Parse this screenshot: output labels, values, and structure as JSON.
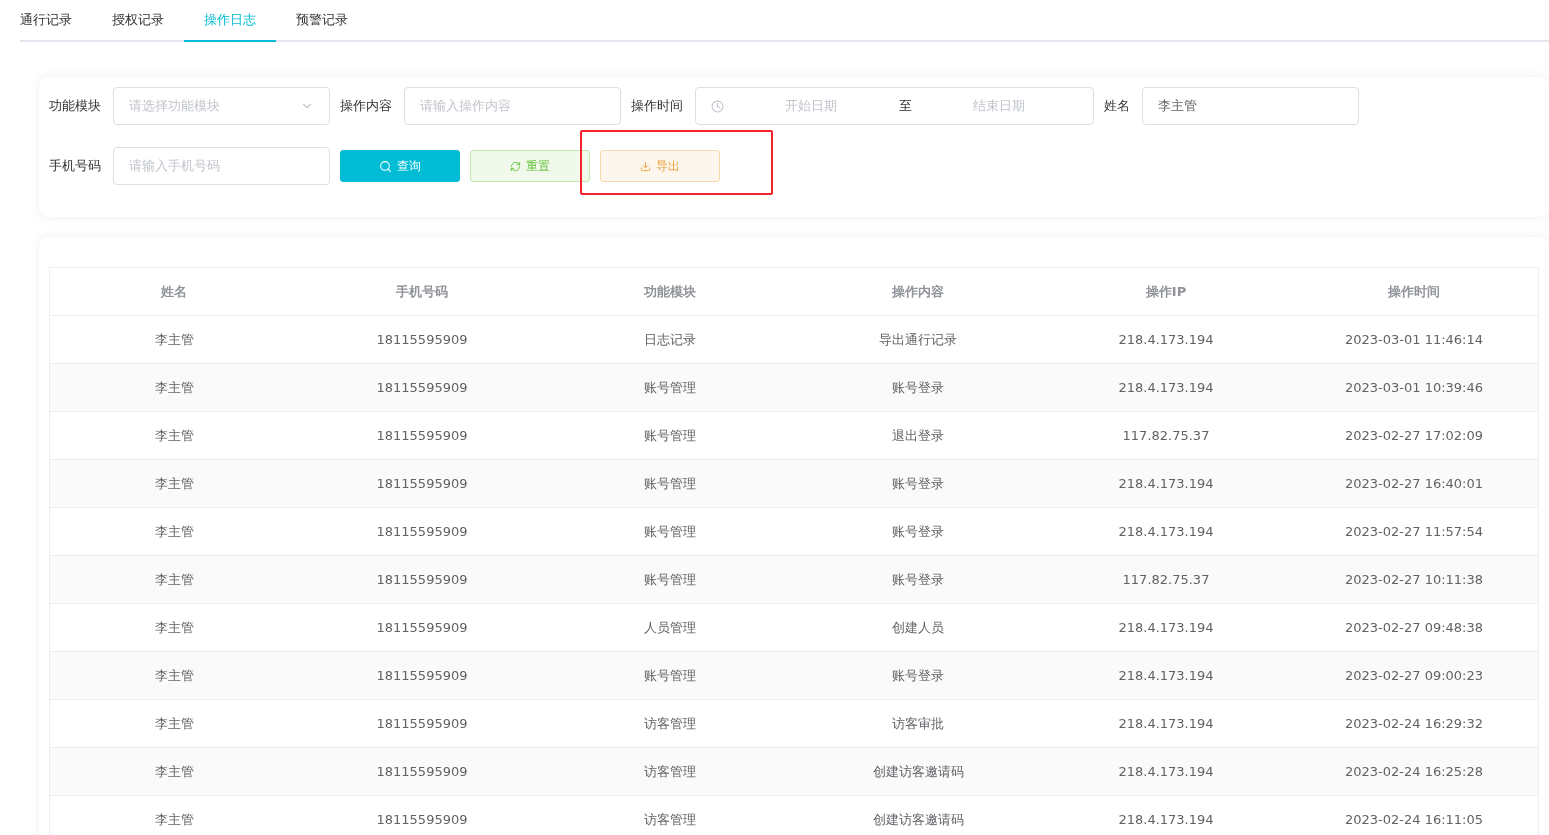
{
  "tabs": [
    {
      "label": "通行记录",
      "selected": false
    },
    {
      "label": "授权记录",
      "selected": false
    },
    {
      "label": "操作日志",
      "selected": true
    },
    {
      "label": "预警记录",
      "selected": false
    }
  ],
  "filters": {
    "module": {
      "label": "功能模块",
      "placeholder": "请选择功能模块"
    },
    "content": {
      "label": "操作内容",
      "placeholder": "请输入操作内容"
    },
    "time": {
      "label": "操作时间",
      "start_placeholder": "开始日期",
      "separator": "至",
      "end_placeholder": "结束日期"
    },
    "name": {
      "label": "姓名",
      "value": "李主管"
    },
    "phone": {
      "label": "手机号码",
      "placeholder": "请输入手机号码"
    }
  },
  "buttons": [
    {
      "kind": "search",
      "label": "查询"
    },
    {
      "kind": "reset",
      "label": "重置"
    },
    {
      "kind": "export",
      "label": "导出",
      "highlighted": true
    }
  ],
  "table": {
    "columns": [
      "姓名",
      "手机号码",
      "功能模块",
      "操作内容",
      "操作IP",
      "操作时间"
    ],
    "rows": [
      [
        "李主管",
        "18115595909",
        "日志记录",
        "导出通行记录",
        "218.4.173.194",
        "2023-03-01 11:46:14"
      ],
      [
        "李主管",
        "18115595909",
        "账号管理",
        "账号登录",
        "218.4.173.194",
        "2023-03-01 10:39:46"
      ],
      [
        "李主管",
        "18115595909",
        "账号管理",
        "退出登录",
        "117.82.75.37",
        "2023-02-27 17:02:09"
      ],
      [
        "李主管",
        "18115595909",
        "账号管理",
        "账号登录",
        "218.4.173.194",
        "2023-02-27 16:40:01"
      ],
      [
        "李主管",
        "18115595909",
        "账号管理",
        "账号登录",
        "218.4.173.194",
        "2023-02-27 11:57:54"
      ],
      [
        "李主管",
        "18115595909",
        "账号管理",
        "账号登录",
        "117.82.75.37",
        "2023-02-27 10:11:38"
      ],
      [
        "李主管",
        "18115595909",
        "人员管理",
        "创建人员",
        "218.4.173.194",
        "2023-02-27 09:48:38"
      ],
      [
        "李主管",
        "18115595909",
        "账号管理",
        "账号登录",
        "218.4.173.194",
        "2023-02-27 09:00:23"
      ],
      [
        "李主管",
        "18115595909",
        "访客管理",
        "访客审批",
        "218.4.173.194",
        "2023-02-24 16:29:32"
      ],
      [
        "李主管",
        "18115595909",
        "访客管理",
        "创建访客邀请码",
        "218.4.173.194",
        "2023-02-24 16:25:28"
      ],
      [
        "李主管",
        "18115595909",
        "访客管理",
        "创建访客邀请码",
        "218.4.173.194",
        "2023-02-24 16:11:05"
      ]
    ]
  }
}
